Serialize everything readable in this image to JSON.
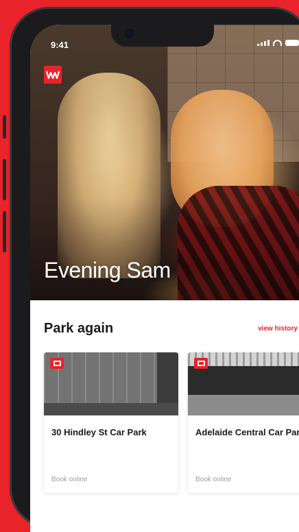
{
  "status_bar": {
    "time": "9:41"
  },
  "hero": {
    "greeting": "Evening Sam",
    "logo_icon": "wilson-parking-logo"
  },
  "park_again": {
    "title": "Park again",
    "history_link": "view history",
    "cards": [
      {
        "name": "30 Hindley St Car Park",
        "action": "Book online"
      },
      {
        "name": "Adelaide Central Car Park",
        "action": "Book online"
      }
    ]
  },
  "colors": {
    "brand_red": "#e8232a",
    "text_dark": "#1a1a1a",
    "muted": "#9b9b9b"
  }
}
